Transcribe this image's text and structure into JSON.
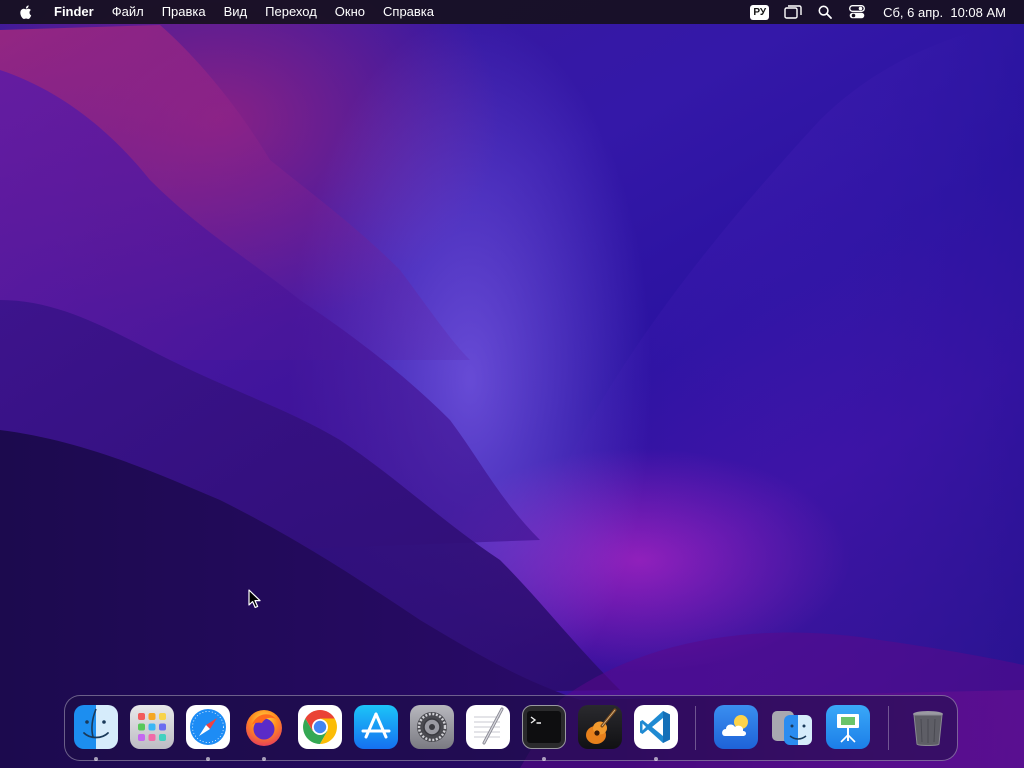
{
  "menubar": {
    "app_name": "Finder",
    "items": [
      "Файл",
      "Правка",
      "Вид",
      "Переход",
      "Окно",
      "Справка"
    ],
    "language_badge": "РУ",
    "date": "Сб, 6 апр.",
    "time": "10:08 AM"
  },
  "icons": {
    "apple": "apple-logo-icon",
    "stage_manager": "stage-manager-icon",
    "search": "spotlight-search-icon",
    "control_center": "control-center-icon"
  },
  "dock": {
    "apps": [
      {
        "name": "Finder",
        "running": true
      },
      {
        "name": "Launchpad",
        "running": false
      },
      {
        "name": "Safari",
        "running": true
      },
      {
        "name": "Firefox",
        "running": true
      },
      {
        "name": "Google Chrome",
        "running": false
      },
      {
        "name": "App Store",
        "running": false
      },
      {
        "name": "System Preferences",
        "running": false
      },
      {
        "name": "TextEdit",
        "running": false
      },
      {
        "name": "Terminal",
        "running": true
      },
      {
        "name": "GarageBand",
        "running": false
      },
      {
        "name": "Visual Studio Code",
        "running": true
      },
      {
        "name": "Weather",
        "running": false
      },
      {
        "name": "Migration Assistant",
        "running": false
      },
      {
        "name": "Keynote",
        "running": false
      },
      {
        "name": "Trash",
        "running": false
      }
    ]
  },
  "colors": {
    "menubar_bg": "#16101e",
    "wallpaper_primary": "#3418a8",
    "wallpaper_accent": "#c828c8"
  }
}
